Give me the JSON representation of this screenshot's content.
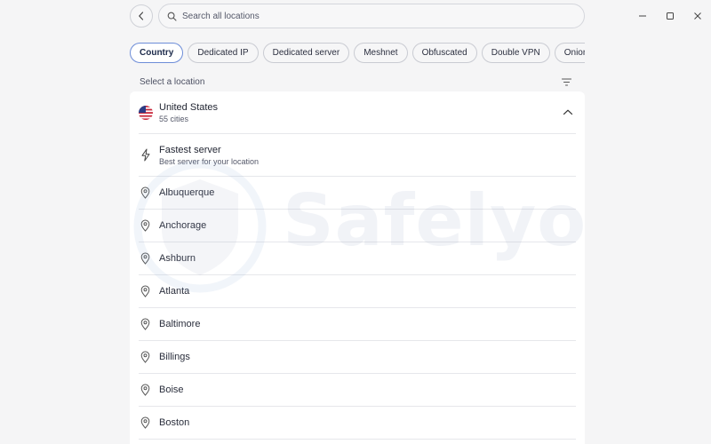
{
  "window": {
    "minimize_icon": "minimize-icon",
    "maximize_icon": "maximize-icon",
    "close_icon": "close-icon"
  },
  "search": {
    "placeholder": "Search all locations"
  },
  "filters": {
    "chips": [
      {
        "label": "Country",
        "active": true
      },
      {
        "label": "Dedicated IP",
        "active": false
      },
      {
        "label": "Dedicated server",
        "active": false
      },
      {
        "label": "Meshnet",
        "active": false
      },
      {
        "label": "Obfuscated",
        "active": false
      },
      {
        "label": "Double VPN",
        "active": false
      },
      {
        "label": "Onion Over VPN",
        "active": false
      }
    ]
  },
  "section": {
    "label": "Select a location"
  },
  "country": {
    "name": "United States",
    "subtitle": "55 cities",
    "expanded": true
  },
  "fastest": {
    "title": "Fastest server",
    "subtitle": "Best server for your location"
  },
  "cities": [
    "Albuquerque",
    "Anchorage",
    "Ashburn",
    "Atlanta",
    "Baltimore",
    "Billings",
    "Boise",
    "Boston"
  ],
  "watermark": {
    "text": "Safelyo"
  },
  "colors": {
    "accent": "#6d8dd8",
    "background": "#f5f5f6",
    "panel": "#ffffff"
  }
}
